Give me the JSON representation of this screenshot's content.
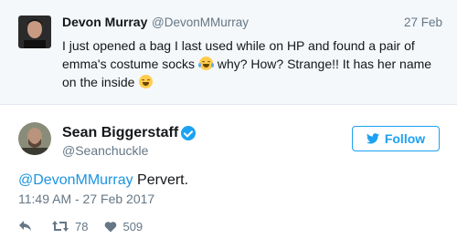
{
  "parent_tweet": {
    "name": "Devon Murray",
    "handle": "@DevonMMurray",
    "date": "27 Feb",
    "text_part1": "I just opened a bag I last used while on HP and found a pair of emma's costume socks",
    "text_part2": "why? How? Strange!! It has her name on the inside",
    "emoji_1": "face-with-tears-of-joy",
    "emoji_2": "grinning-squinting-face"
  },
  "tweet": {
    "name": "Sean Biggerstaff",
    "handle": "@Seanchuckle",
    "verified": true,
    "follow_label": "Follow",
    "mention": "@DevonMMurray",
    "body": " Pervert.",
    "timestamp": "11:49 AM - 27 Feb 2017",
    "retweets": "78",
    "likes": "509"
  },
  "colors": {
    "accent": "#1da1f2",
    "mention": "#1b95e0",
    "muted": "#657786",
    "parent_bg": "#f5f8fa",
    "heart": "#657786"
  },
  "icons": [
    "reply-icon",
    "retweet-icon",
    "heart-icon",
    "verified-badge-icon",
    "twitter-bird-icon"
  ]
}
